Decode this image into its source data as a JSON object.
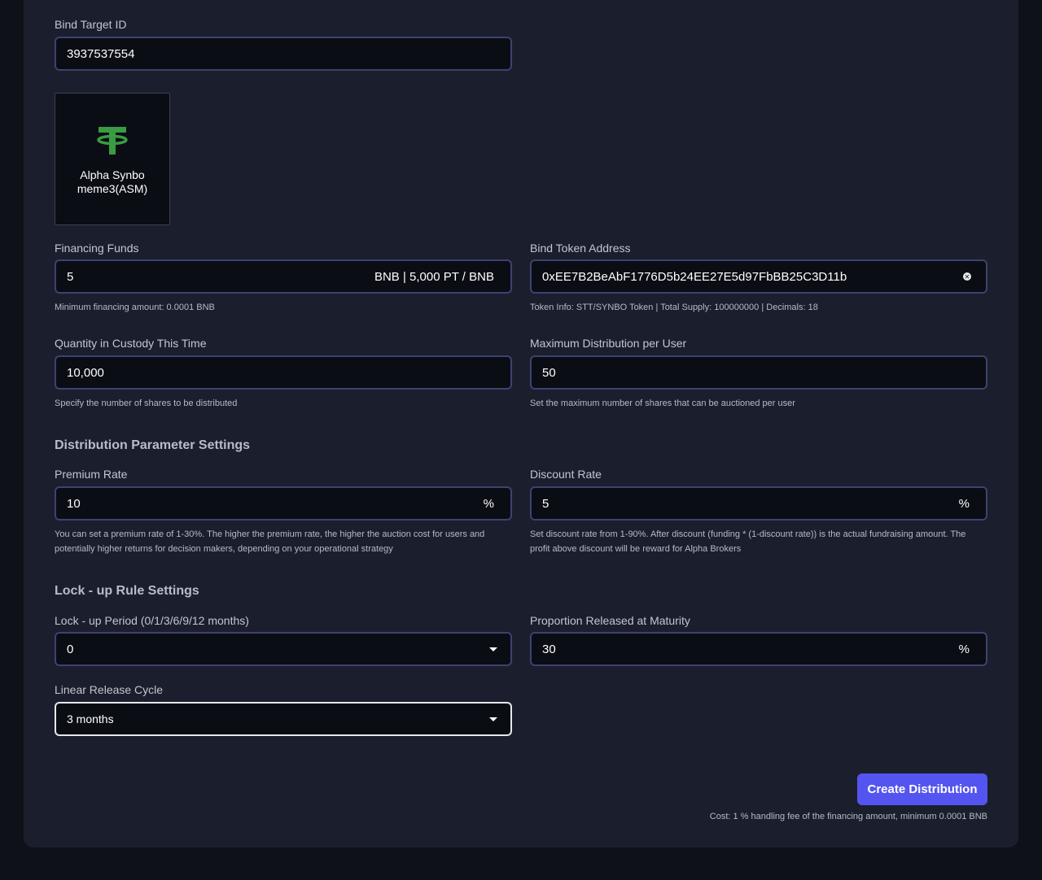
{
  "bind_target": {
    "label": "Bind Target ID",
    "value": "3937537554"
  },
  "token_card": {
    "name_line1": "Alpha Synbo",
    "name_line2": "meme3(ASM)",
    "icon": "tether-icon",
    "icon_color": "#3a9b43"
  },
  "financing": {
    "label": "Financing Funds",
    "value": "5",
    "suffix": "BNB | 5,000 PT / BNB",
    "hint": "Minimum financing amount: 0.0001 BNB"
  },
  "bind_token": {
    "label": "Bind Token Address",
    "value": "0xEE7B2BeAbF1776D5b24EE27E5d97FbBB25C3D11b",
    "hint": "Token Info: STT/SYNBO Token | Total Supply: 100000000 | Decimals: 18"
  },
  "custody": {
    "label": "Quantity in Custody This Time",
    "value": "10,000",
    "hint": "Specify the number of shares to be distributed"
  },
  "max_dist": {
    "label": "Maximum Distribution per User",
    "value": "50",
    "hint": "Set the maximum number of shares that can be auctioned per user"
  },
  "dist_section": {
    "title": "Distribution Parameter Settings"
  },
  "premium": {
    "label": "Premium Rate",
    "value": "10",
    "suffix": "%",
    "hint_line1": "You can set a premium rate of 1-30%. The higher the premium rate, the higher the auction cost for users and",
    "hint_line2": "potentially higher returns for decision makers, depending on your operational strategy"
  },
  "discount": {
    "label": "Discount Rate",
    "value": "5",
    "suffix": "%",
    "hint_line1": "Set discount rate from 1-90%. After discount (funding * (1-discount rate)) is the actual fundraising amount. The",
    "hint_line2": "profit above discount will be reward for Alpha Brokers"
  },
  "lock_section": {
    "title": "Lock - up Rule Settings"
  },
  "lock_period": {
    "label": "Lock - up Period (0/1/3/6/9/12 months)",
    "value": "0"
  },
  "proportion": {
    "label": "Proportion Released at Maturity",
    "value": "30",
    "suffix": "%"
  },
  "linear": {
    "label": "Linear Release Cycle",
    "value": "3 months"
  },
  "create": {
    "button": "Create Distribution",
    "cost": "Cost: 1 % handling fee of the financing amount, minimum 0.0001 BNB"
  },
  "colors": {
    "accent": "#5455f0",
    "panel": "#1b1f2d",
    "input_bg": "#0b0d14",
    "input_border": "#3d4270"
  }
}
